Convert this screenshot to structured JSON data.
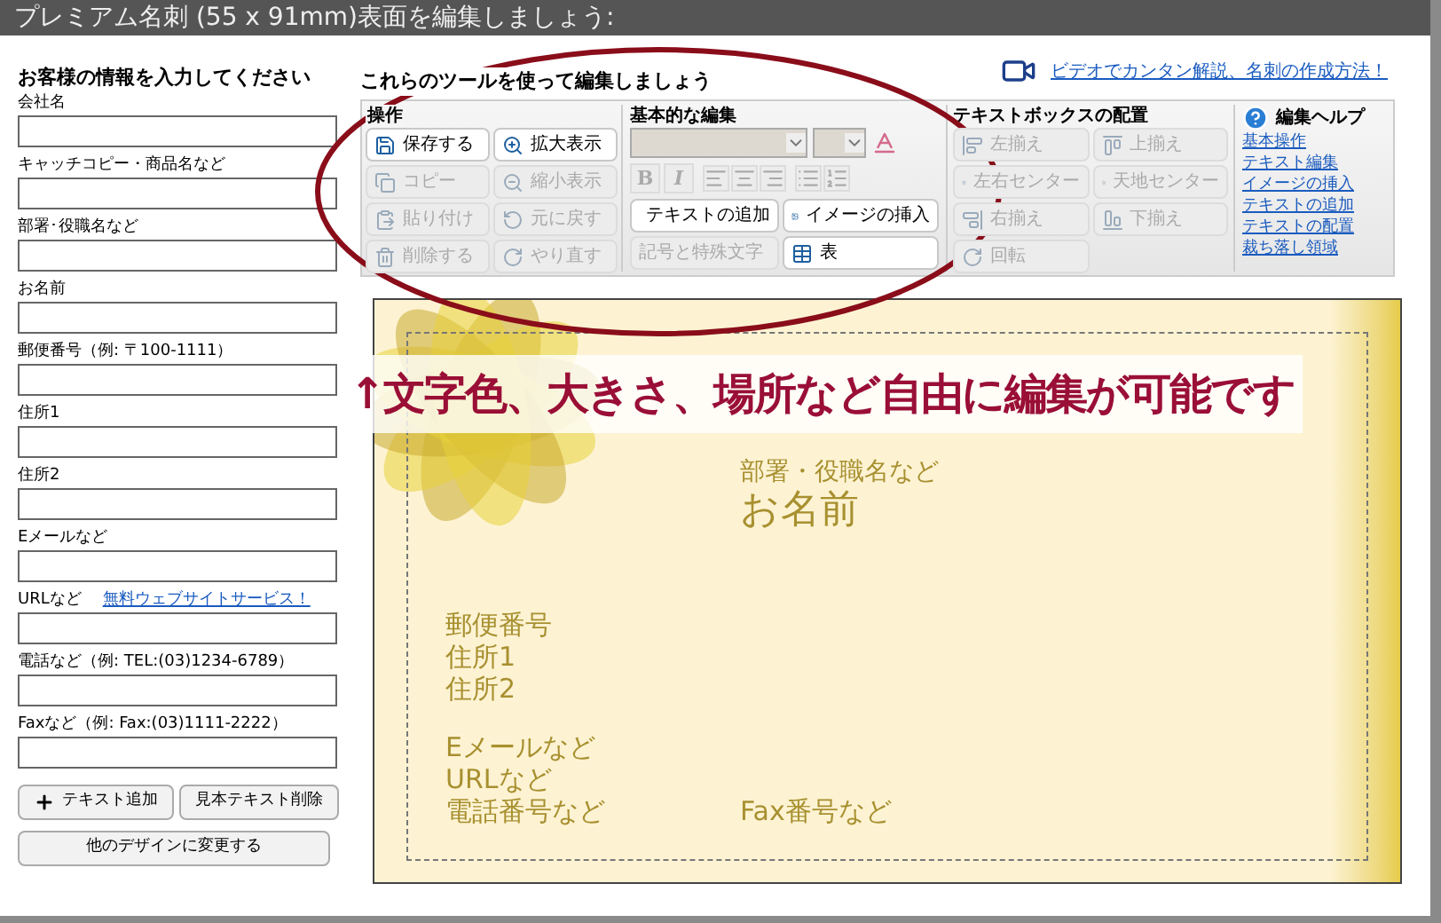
{
  "title": "プレミアム名刺 (55 x 91mm)表面を編集しましょう:",
  "form": {
    "heading": "お客様の情報を入力してください",
    "fields": [
      {
        "label": "会社名"
      },
      {
        "label": "キャッチコピー・商品名など"
      },
      {
        "label": "部署･役職名など"
      },
      {
        "label": "お名前"
      },
      {
        "label": "郵便番号（例: 〒100-1111）"
      },
      {
        "label": "住所1"
      },
      {
        "label": "住所2"
      },
      {
        "label": "Eメールなど"
      },
      {
        "label": "URLなど",
        "link": "無料ウェブサイトサービス！"
      },
      {
        "label": "電話など（例: TEL:(03)1234-6789）"
      },
      {
        "label": "Faxなど（例: Fax:(03)1111-2222）"
      }
    ],
    "buttons": [
      {
        "label": "テキスト追加",
        "kind": "add"
      },
      {
        "label": "見本テキスト削除",
        "kind": "plain"
      }
    ],
    "change_button": "他のデザインに変更する"
  },
  "tools": {
    "heading": "これらのツールを使って編集しましょう",
    "video_link": "ビデオでカンタン解説、名刺の作成方法！",
    "operations": {
      "title": "操作",
      "buttons": [
        {
          "label": "保存する",
          "disabled": false
        },
        {
          "label": "拡大表示",
          "disabled": false
        },
        {
          "label": "コピー",
          "disabled": true
        },
        {
          "label": "縮小表示",
          "disabled": true
        },
        {
          "label": "貼り付け",
          "disabled": true
        },
        {
          "label": "元に戻す",
          "disabled": true
        },
        {
          "label": "削除する",
          "disabled": true
        },
        {
          "label": "やり直す",
          "disabled": true
        }
      ]
    },
    "basic": {
      "title": "基本的な編集",
      "format_buttons": [
        {
          "label": "B",
          "disabled": true
        },
        {
          "label": "I",
          "disabled": true
        }
      ],
      "buttons": [
        {
          "label": "テキストの追加",
          "disabled": false
        },
        {
          "label": "イメージの挿入",
          "disabled": false
        },
        {
          "label": "記号と特殊文字",
          "disabled": true
        },
        {
          "label": "表",
          "disabled": false
        }
      ]
    },
    "align": {
      "title": "テキストボックスの配置",
      "buttons": [
        {
          "label": "左揃え",
          "disabled": true
        },
        {
          "label": "上揃え",
          "disabled": true
        },
        {
          "label": "左右センター",
          "disabled": true
        },
        {
          "label": "天地センター",
          "disabled": true
        },
        {
          "label": "右揃え",
          "disabled": true
        },
        {
          "label": "下揃え",
          "disabled": true
        },
        {
          "label": "回転",
          "disabled": true
        }
      ]
    },
    "help": {
      "title": "編集ヘルプ",
      "links": [
        "基本操作",
        "テキスト編集",
        "イメージの挿入",
        "テキストの追加",
        "テキストの配置",
        "裁ち落し領域"
      ]
    }
  },
  "annotation": "↑文字色、大きさ、場所など自由に編集が可能です",
  "card": {
    "texts": [
      {
        "text": "部署・役職名など",
        "kind": "title"
      },
      {
        "text": "お名前",
        "kind": "name"
      },
      {
        "text": "郵便番号",
        "kind": "line"
      },
      {
        "text": "住所1",
        "kind": "line"
      },
      {
        "text": "住所2",
        "kind": "line"
      },
      {
        "text": "Eメールなど",
        "kind": "line"
      },
      {
        "text": "URLなど",
        "kind": "line"
      },
      {
        "text": "電話番号など",
        "kind": "line"
      },
      {
        "text": "Fax番号など",
        "kind": "line"
      }
    ]
  }
}
